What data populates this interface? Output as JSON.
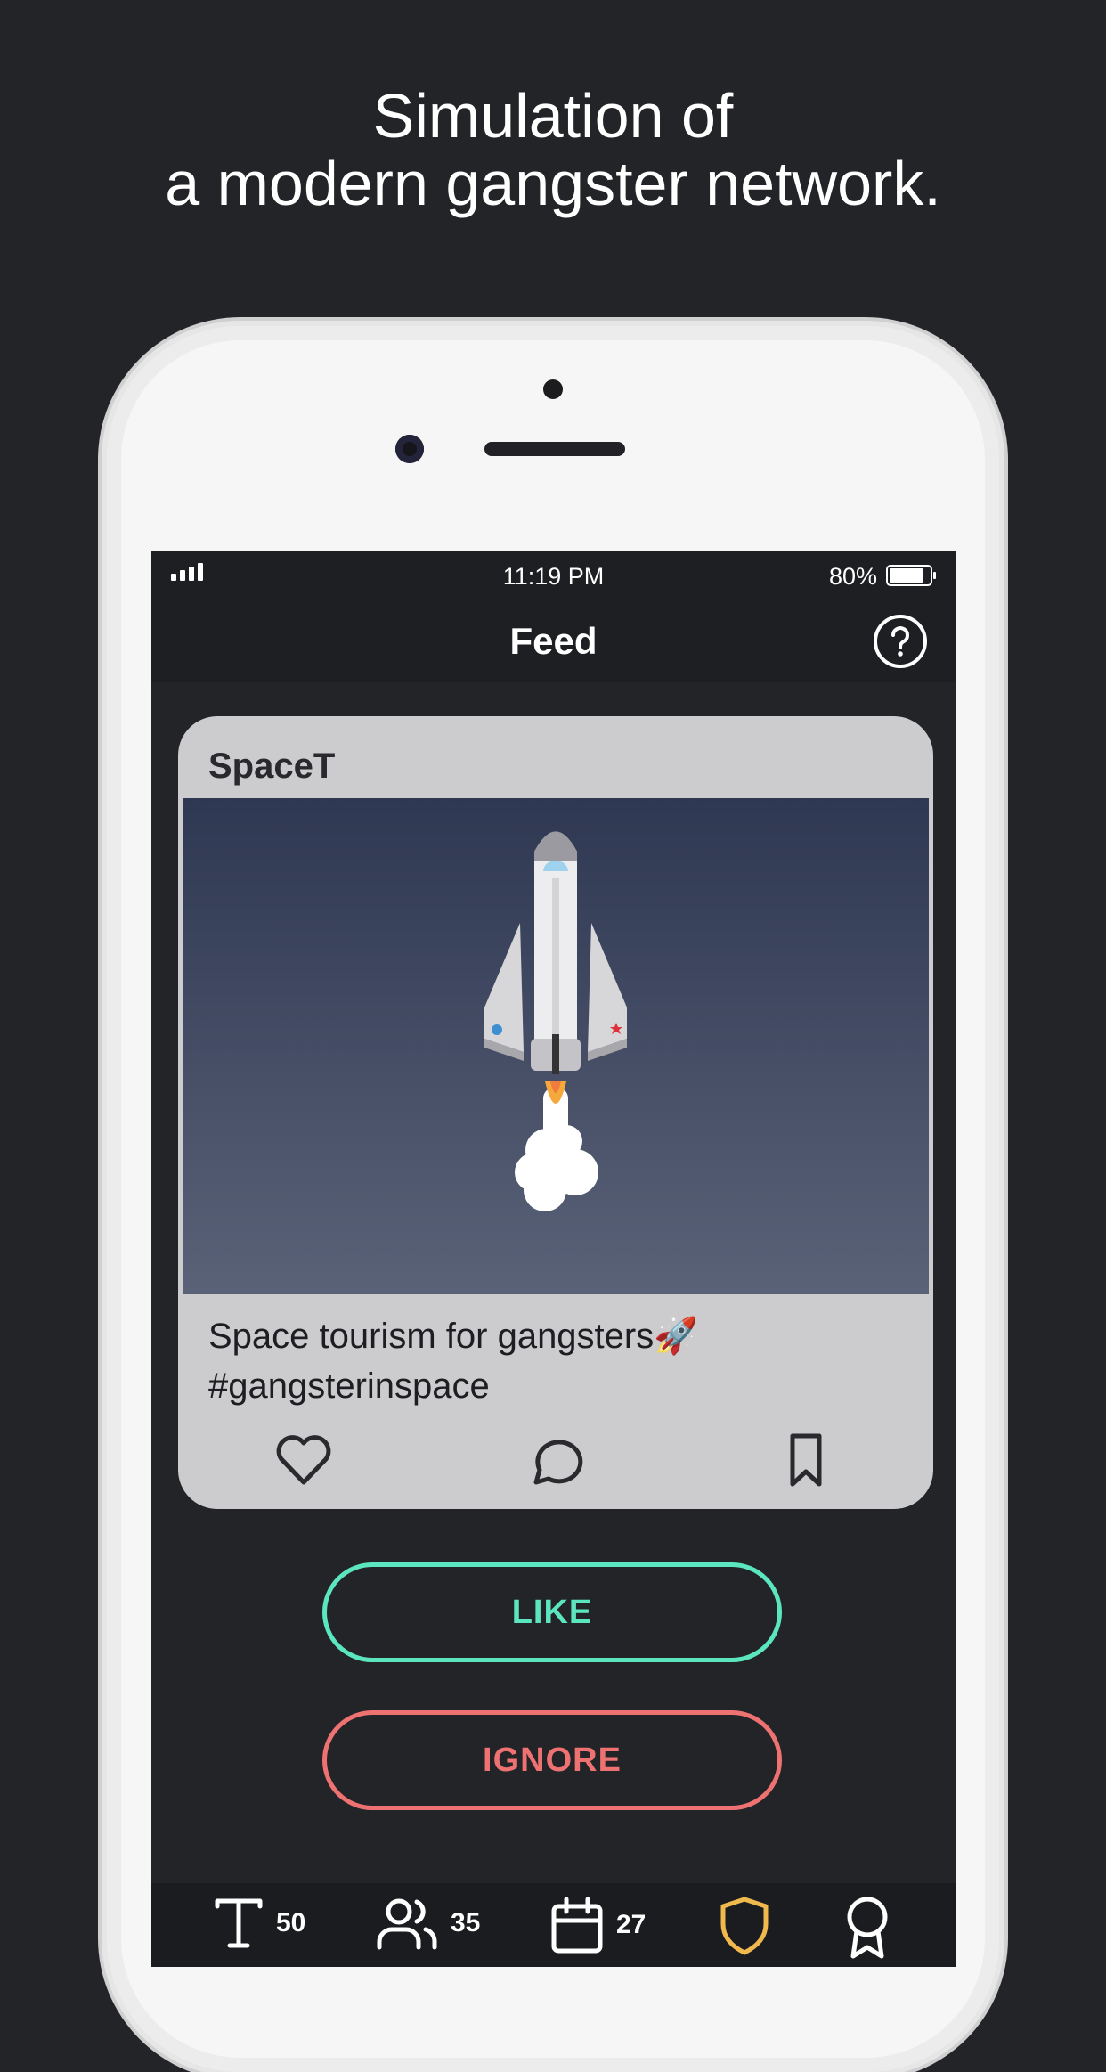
{
  "headline": {
    "line1": "Simulation of",
    "line2": "a modern gangster network."
  },
  "statusbar": {
    "time": "11:19 PM",
    "battery": "80%"
  },
  "navbar": {
    "title": "Feed",
    "help_icon": "question-circle-icon"
  },
  "post": {
    "author": "SpaceT",
    "image": "space-shuttle-launch-illustration",
    "caption_line1": "Space tourism for gangsters🚀",
    "caption_line2": "#gangsterinspace",
    "actions": [
      "heart-icon",
      "comment-icon",
      "bookmark-icon"
    ]
  },
  "buttons": {
    "like": "LIKE",
    "ignore": "IGNORE"
  },
  "tabbar": {
    "items": [
      {
        "icon": "text-icon",
        "count": "50"
      },
      {
        "icon": "users-icon",
        "count": "35"
      },
      {
        "icon": "calendar-icon",
        "count": "27"
      },
      {
        "icon": "shield-icon",
        "count": ""
      },
      {
        "icon": "award-icon",
        "count": ""
      }
    ]
  },
  "colors": {
    "background": "#232428",
    "like": "#5ce6bf",
    "ignore": "#ef7272",
    "shield": "#f0b94e",
    "card": "#ccccce"
  }
}
